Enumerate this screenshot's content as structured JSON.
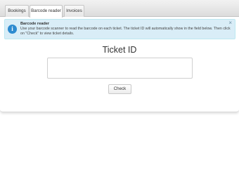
{
  "tabs": [
    {
      "label": "Bookings"
    },
    {
      "label": "Barcode reader"
    },
    {
      "label": "Invoices"
    }
  ],
  "active_tab": "Barcode reader",
  "alert": {
    "title": "Barcode reader",
    "text": "Use your barcode scanner to read the barcode on each ticket. The ticket ID will automatically show in the field below. Then click on \"Check\" to view ticket details.",
    "close": "×",
    "icon": "info-icon"
  },
  "ticket": {
    "title": "Ticket ID",
    "value": "",
    "check_label": "Check"
  },
  "colors": {
    "alert_bg": "#d9edf7",
    "info_icon": "#2e8bd0"
  }
}
